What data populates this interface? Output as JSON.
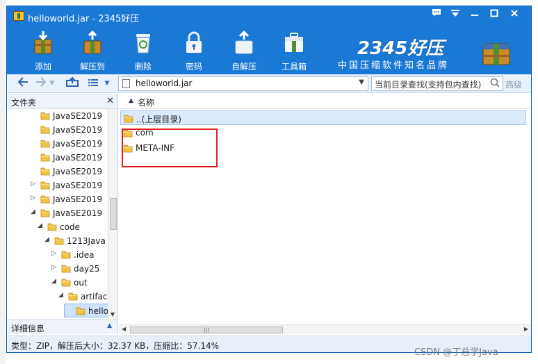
{
  "window": {
    "title": "helloworld.jar - 2345好压",
    "controls": [
      "feedback-icon",
      "menu-icon",
      "minimize-icon",
      "maximize-icon",
      "close-icon"
    ]
  },
  "toolbar": {
    "items": [
      {
        "label": "添加",
        "icon": "add-icon"
      },
      {
        "label": "解压到",
        "icon": "extract-to-icon"
      },
      {
        "label": "删除",
        "icon": "delete-icon"
      },
      {
        "label": "密码",
        "icon": "password-icon"
      },
      {
        "label": "自解压",
        "icon": "self-extract-icon"
      },
      {
        "label": "工具箱",
        "icon": "toolbox-icon"
      }
    ],
    "brand_number": "2345好压",
    "brand_slogan": "中国压缩软件知名品牌"
  },
  "navbar": {
    "path": "helloworld.jar",
    "search_placeholder": "当前目录查找(支持包内查找)",
    "advanced": "高级"
  },
  "tree": {
    "header": "文件夹",
    "rows": [
      {
        "label": "JavaSE2019",
        "depth": 0,
        "arrow": ""
      },
      {
        "label": "JavaSE2019",
        "depth": 0,
        "arrow": ""
      },
      {
        "label": "JavaSE2019",
        "depth": 0,
        "arrow": ""
      },
      {
        "label": "JavaSE2019",
        "depth": 0,
        "arrow": ""
      },
      {
        "label": "JavaSE2019",
        "depth": 0,
        "arrow": ""
      },
      {
        "label": "JavaSE2019",
        "depth": 0,
        "arrow": "▷"
      },
      {
        "label": "JavaSE2019",
        "depth": 0,
        "arrow": "▷"
      },
      {
        "label": "JavaSE2019",
        "depth": 0,
        "arrow": "◢"
      },
      {
        "label": "code",
        "depth": 1,
        "arrow": "◢"
      },
      {
        "label": "1213Java",
        "depth": 2,
        "arrow": "◢"
      },
      {
        "label": ".idea",
        "depth": 3,
        "arrow": "▷"
      },
      {
        "label": "day25",
        "depth": 3,
        "arrow": "▷"
      },
      {
        "label": "out",
        "depth": 3,
        "arrow": "◢"
      },
      {
        "label": "artifacts",
        "depth": 4,
        "arrow": "◢"
      },
      {
        "label": "helloworld",
        "depth": 5,
        "arrow": "",
        "selected": true
      }
    ],
    "details_label": "详细信息"
  },
  "list": {
    "column_name": "名称",
    "rows": [
      {
        "label": "..(上层目录)",
        "highlighted": true
      },
      {
        "label": "com",
        "highlighted": false
      },
      {
        "label": "META-INF",
        "highlighted": false
      }
    ]
  },
  "status": {
    "text": "类型：ZIP，解压后大小：32.37 KB，压缩比：57.14%"
  },
  "watermark": "CSDN @丁总学Java",
  "colors": {
    "frame_blue": "#1b79d6",
    "folder_yellow": "#f2c443",
    "highlight_red": "#e02020"
  }
}
